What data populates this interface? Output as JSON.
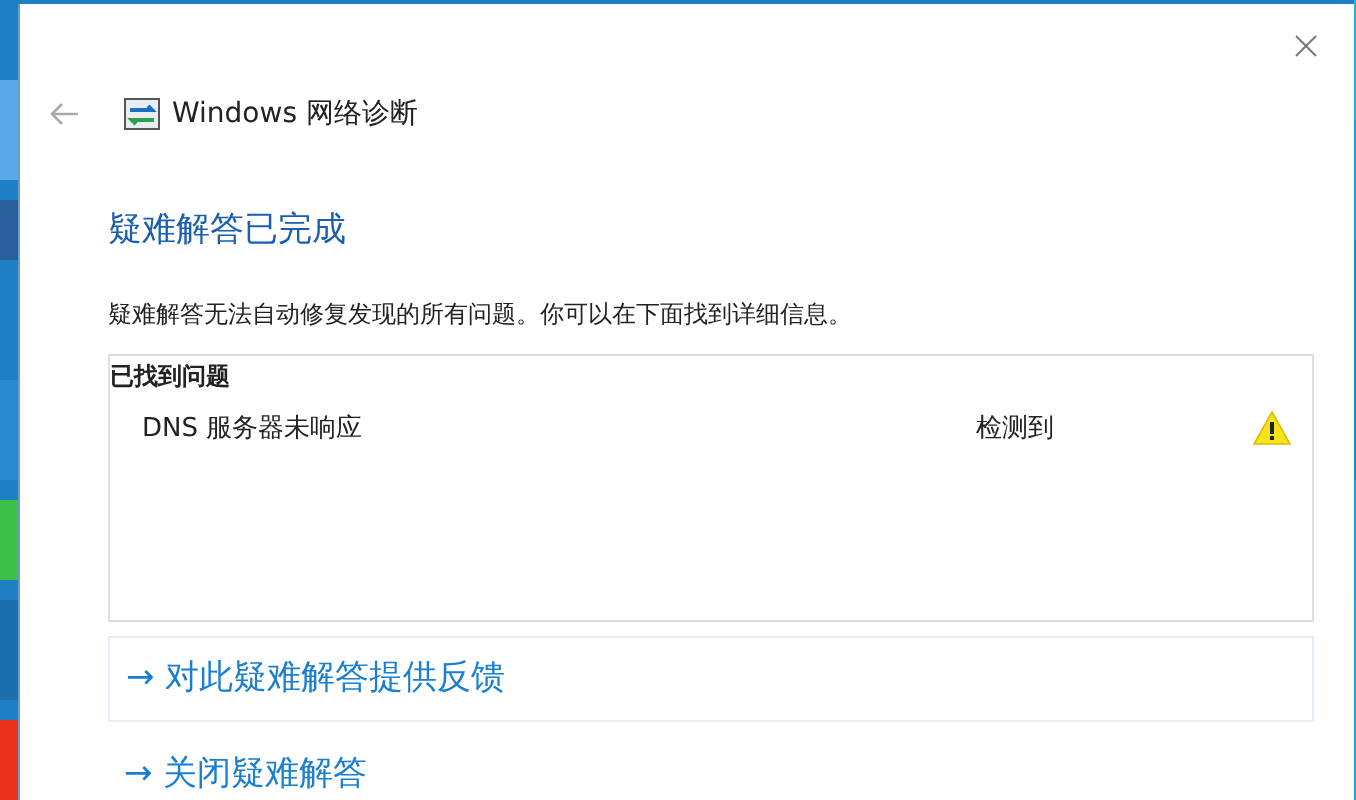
{
  "window": {
    "title": "Windows 网络诊断"
  },
  "heading": "疑难解答已完成",
  "description": "疑难解答无法自动修复发现的所有问题。你可以在下面找到详细信息。",
  "problems": {
    "header": "已找到问题",
    "rows": [
      {
        "name": "DNS 服务器未响应",
        "status": "检测到",
        "kind": "warning"
      }
    ]
  },
  "links": [
    {
      "label": "→ 对此疑难解答提供反馈",
      "boxed": true
    },
    {
      "label": "→ 关闭疑难解答",
      "boxed": false
    }
  ]
}
